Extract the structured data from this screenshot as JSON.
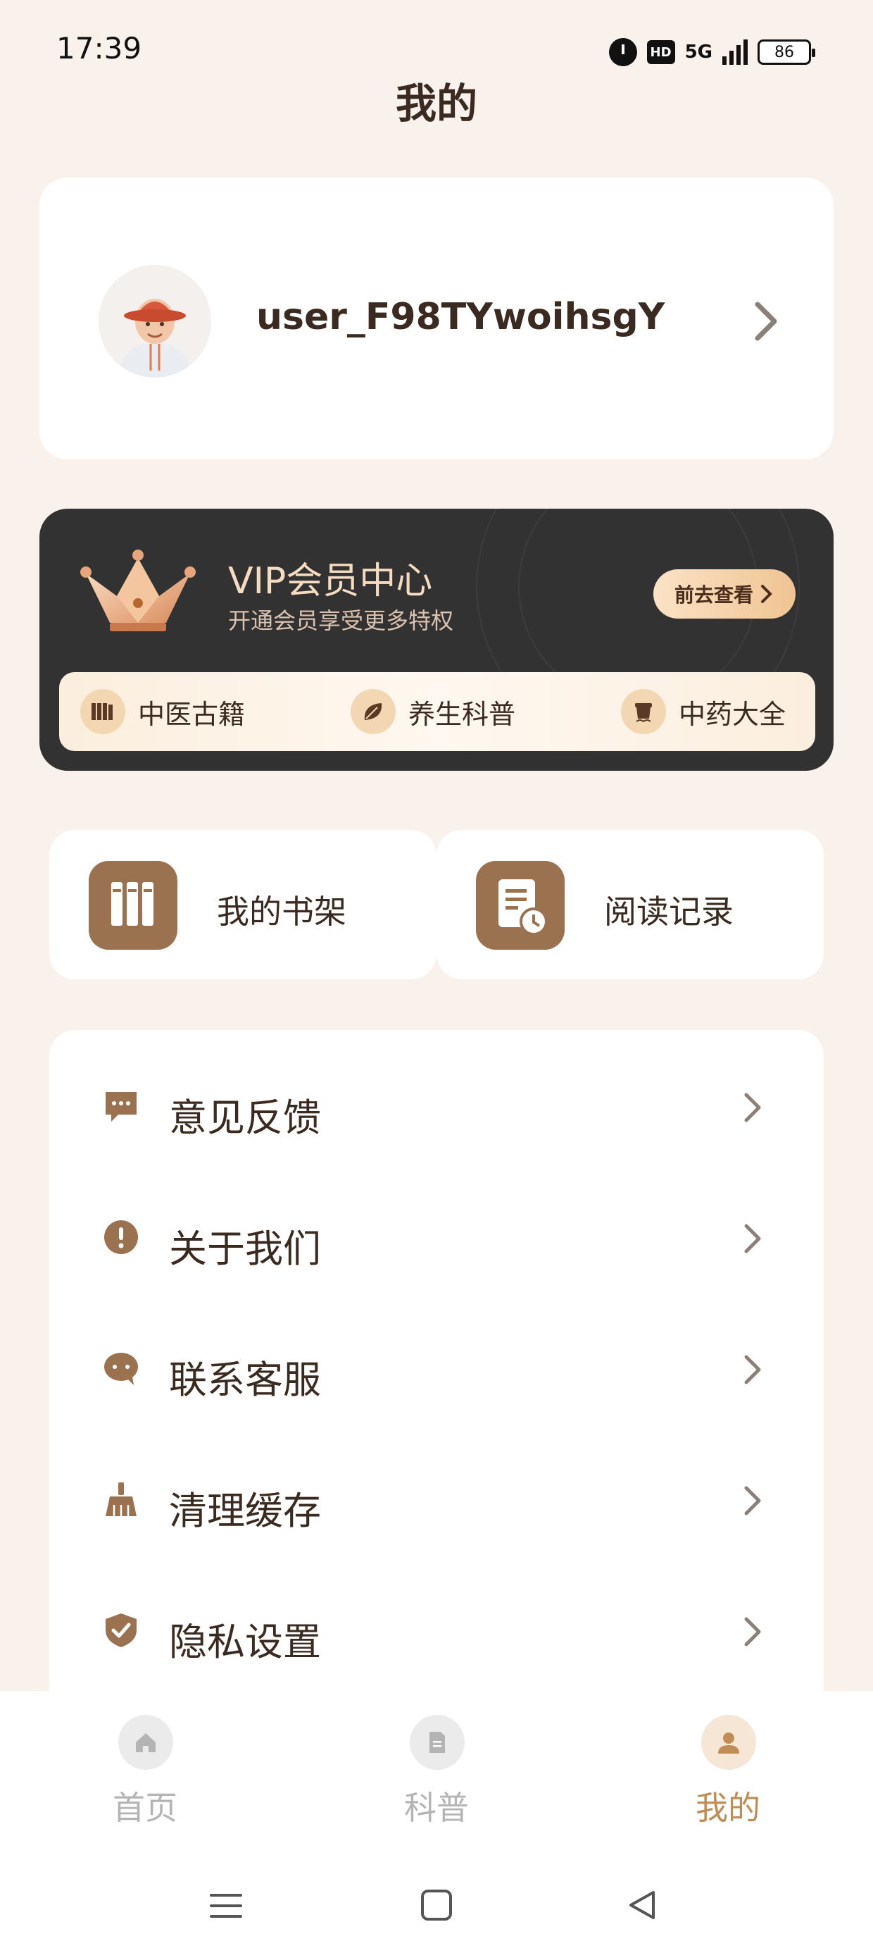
{
  "status_bar": {
    "time": "17:39",
    "hd": "HD",
    "network": "5G",
    "battery": "86"
  },
  "page_title": "我的",
  "profile": {
    "username": "user_F98TYwoihsgY",
    "avatar_icon": "avatar-bucket-hat"
  },
  "vip": {
    "title": "VIP会员中心",
    "subtitle": "开通会员享受更多特权",
    "button_label": "前去查看",
    "features": [
      {
        "label": "中医古籍",
        "icon": "books-icon"
      },
      {
        "label": "养生科普",
        "icon": "leaf-icon"
      },
      {
        "label": "中药大全",
        "icon": "herb-pot-icon"
      }
    ]
  },
  "quick": [
    {
      "label": "我的书架",
      "icon": "bookshelf-icon"
    },
    {
      "label": "阅读记录",
      "icon": "reading-history-icon"
    }
  ],
  "menu": [
    {
      "label": "意见反馈",
      "icon": "feedback-icon"
    },
    {
      "label": "关于我们",
      "icon": "info-icon"
    },
    {
      "label": "联系客服",
      "icon": "customer-service-icon"
    },
    {
      "label": "清理缓存",
      "icon": "broom-icon"
    },
    {
      "label": "隐私设置",
      "icon": "shield-check-icon"
    }
  ],
  "tabs": [
    {
      "label": "首页",
      "icon": "home-icon",
      "active": false
    },
    {
      "label": "科普",
      "icon": "article-icon",
      "active": false
    },
    {
      "label": "我的",
      "icon": "person-icon",
      "active": true
    }
  ],
  "colors": {
    "background": "#f8f1ec",
    "brown_accent": "#9b7250",
    "active_tab": "#c08d54",
    "inactive_tab": "#b4b4b4",
    "vip_card": "#323232",
    "vip_gold": "#f5dcc0"
  }
}
